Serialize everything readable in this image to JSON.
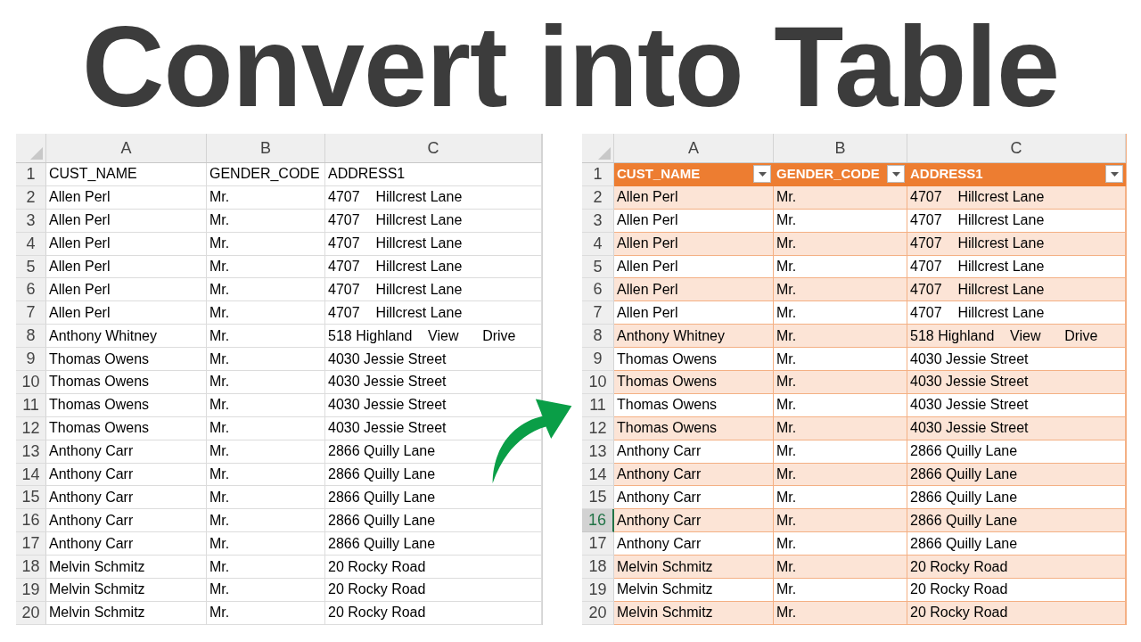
{
  "title": "Convert into Table",
  "sheets": [
    {
      "formatted": false,
      "columns": [
        "A",
        "B",
        "C"
      ],
      "rows": [
        {
          "number": "1",
          "cells": [
            "CUST_NAME",
            "GENDER_CODE",
            "ADDRESS1"
          ],
          "selected": false
        },
        {
          "number": "2",
          "cells": [
            "Allen Perl",
            "Mr.",
            "4707    Hillcrest Lane"
          ],
          "selected": false
        },
        {
          "number": "3",
          "cells": [
            "Allen Perl",
            "Mr.",
            "4707    Hillcrest Lane"
          ],
          "selected": false
        },
        {
          "number": "4",
          "cells": [
            "Allen Perl",
            "Mr.",
            "4707    Hillcrest Lane"
          ],
          "selected": false
        },
        {
          "number": "5",
          "cells": [
            "Allen Perl",
            "Mr.",
            "4707    Hillcrest Lane"
          ],
          "selected": false
        },
        {
          "number": "6",
          "cells": [
            "Allen Perl",
            "Mr.",
            "4707    Hillcrest Lane"
          ],
          "selected": false
        },
        {
          "number": "7",
          "cells": [
            "Allen Perl",
            "Mr.",
            "4707    Hillcrest Lane"
          ],
          "selected": false
        },
        {
          "number": "8",
          "cells": [
            "Anthony Whitney",
            "Mr.",
            "518 Highland    View      Drive"
          ],
          "selected": false
        },
        {
          "number": "9",
          "cells": [
            "Thomas Owens",
            "Mr.",
            "4030 Jessie Street"
          ],
          "selected": false
        },
        {
          "number": "10",
          "cells": [
            "Thomas Owens",
            "Mr.",
            "4030 Jessie Street"
          ],
          "selected": false
        },
        {
          "number": "11",
          "cells": [
            "Thomas Owens",
            "Mr.",
            "4030 Jessie Street"
          ],
          "selected": false
        },
        {
          "number": "12",
          "cells": [
            "Thomas Owens",
            "Mr.",
            "4030 Jessie Street"
          ],
          "selected": false
        },
        {
          "number": "13",
          "cells": [
            "Anthony Carr",
            "Mr.",
            "2866 Quilly Lane"
          ],
          "selected": false
        },
        {
          "number": "14",
          "cells": [
            "Anthony Carr",
            "Mr.",
            "2866 Quilly Lane"
          ],
          "selected": false
        },
        {
          "number": "15",
          "cells": [
            "Anthony Carr",
            "Mr.",
            "2866 Quilly Lane"
          ],
          "selected": false
        },
        {
          "number": "16",
          "cells": [
            "Anthony Carr",
            "Mr.",
            "2866 Quilly Lane"
          ],
          "selected": false
        },
        {
          "number": "17",
          "cells": [
            "Anthony Carr",
            "Mr.",
            "2866 Quilly Lane"
          ],
          "selected": false
        },
        {
          "number": "18",
          "cells": [
            "Melvin Schmitz",
            "Mr.",
            "20 Rocky Road"
          ],
          "selected": false
        },
        {
          "number": "19",
          "cells": [
            "Melvin Schmitz",
            "Mr.",
            "20 Rocky Road"
          ],
          "selected": false
        },
        {
          "number": "20",
          "cells": [
            "Melvin Schmitz",
            "Mr.",
            "20 Rocky Road"
          ],
          "selected": false
        }
      ]
    },
    {
      "formatted": true,
      "columns": [
        "A",
        "B",
        "C"
      ],
      "rows": [
        {
          "number": "1",
          "cells": [
            "CUST_NAME",
            "GENDER_CODE",
            "ADDRESS1"
          ],
          "selected": false
        },
        {
          "number": "2",
          "cells": [
            "Allen Perl",
            "Mr.",
            "4707    Hillcrest Lane"
          ],
          "selected": false
        },
        {
          "number": "3",
          "cells": [
            "Allen Perl",
            "Mr.",
            "4707    Hillcrest Lane"
          ],
          "selected": false
        },
        {
          "number": "4",
          "cells": [
            "Allen Perl",
            "Mr.",
            "4707    Hillcrest Lane"
          ],
          "selected": false
        },
        {
          "number": "5",
          "cells": [
            "Allen Perl",
            "Mr.",
            "4707    Hillcrest Lane"
          ],
          "selected": false
        },
        {
          "number": "6",
          "cells": [
            "Allen Perl",
            "Mr.",
            "4707    Hillcrest Lane"
          ],
          "selected": false
        },
        {
          "number": "7",
          "cells": [
            "Allen Perl",
            "Mr.",
            "4707    Hillcrest Lane"
          ],
          "selected": false
        },
        {
          "number": "8",
          "cells": [
            "Anthony Whitney",
            "Mr.",
            "518 Highland    View      Drive"
          ],
          "selected": false
        },
        {
          "number": "9",
          "cells": [
            "Thomas Owens",
            "Mr.",
            "4030 Jessie Street"
          ],
          "selected": false
        },
        {
          "number": "10",
          "cells": [
            "Thomas Owens",
            "Mr.",
            "4030 Jessie Street"
          ],
          "selected": false
        },
        {
          "number": "11",
          "cells": [
            "Thomas Owens",
            "Mr.",
            "4030 Jessie Street"
          ],
          "selected": false
        },
        {
          "number": "12",
          "cells": [
            "Thomas Owens",
            "Mr.",
            "4030 Jessie Street"
          ],
          "selected": false
        },
        {
          "number": "13",
          "cells": [
            "Anthony Carr",
            "Mr.",
            "2866 Quilly Lane"
          ],
          "selected": false
        },
        {
          "number": "14",
          "cells": [
            "Anthony Carr",
            "Mr.",
            "2866 Quilly Lane"
          ],
          "selected": false
        },
        {
          "number": "15",
          "cells": [
            "Anthony Carr",
            "Mr.",
            "2866 Quilly Lane"
          ],
          "selected": false
        },
        {
          "number": "16",
          "cells": [
            "Anthony Carr",
            "Mr.",
            "2866 Quilly Lane"
          ],
          "selected": true
        },
        {
          "number": "17",
          "cells": [
            "Anthony Carr",
            "Mr.",
            "2866 Quilly Lane"
          ],
          "selected": false
        },
        {
          "number": "18",
          "cells": [
            "Melvin Schmitz",
            "Mr.",
            "20 Rocky Road"
          ],
          "selected": false
        },
        {
          "number": "19",
          "cells": [
            "Melvin Schmitz",
            "Mr.",
            "20 Rocky Road"
          ],
          "selected": false
        },
        {
          "number": "20",
          "cells": [
            "Melvin Schmitz",
            "Mr.",
            "20 Rocky Road"
          ],
          "selected": false
        }
      ]
    }
  ]
}
